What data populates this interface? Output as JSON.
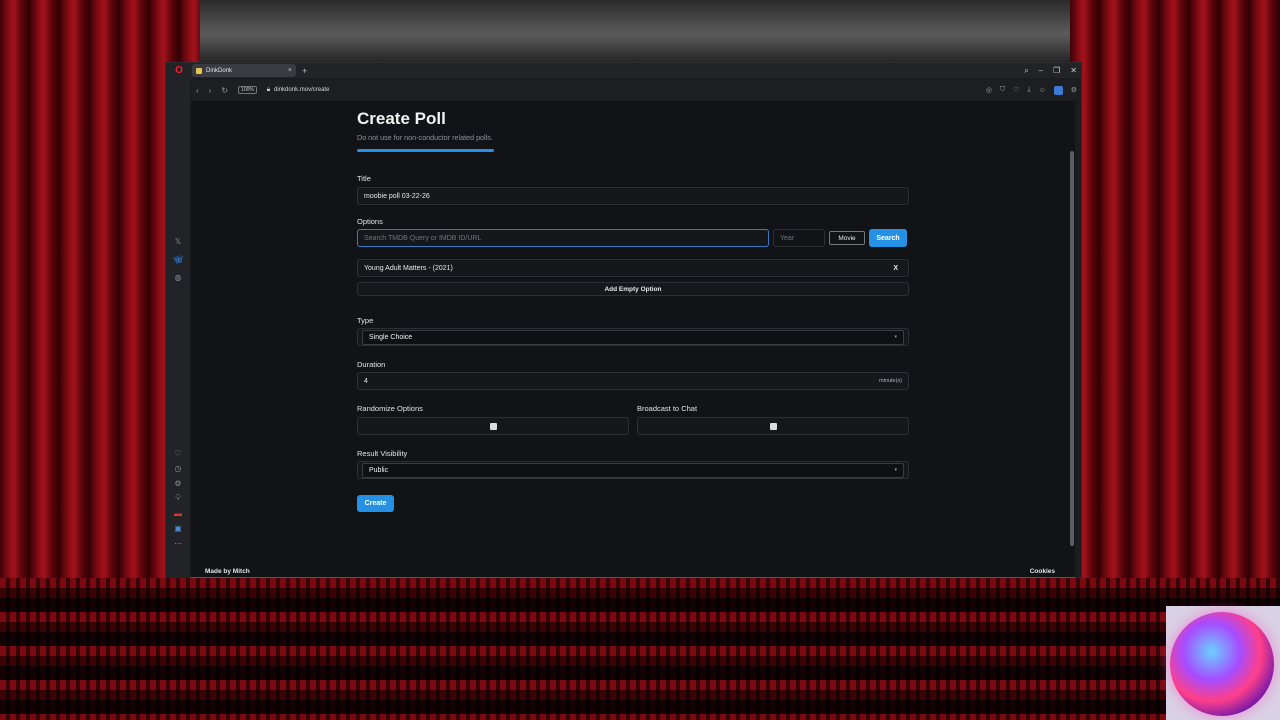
{
  "browser": {
    "tab_title": "DinkDonk",
    "address": "dinkdonk.mov/create",
    "zoom": "100%"
  },
  "page": {
    "title": "Create Poll",
    "subtitle": "Do not use for non-conductor related polls.",
    "title_label": "Title",
    "title_value": "moobie poll 03-22-26",
    "options_label": "Options",
    "search_placeholder": "Search TMDB Query or IMDB ID/URL",
    "year_placeholder": "Year",
    "media_type": "Movie",
    "search_button": "Search",
    "options": [
      {
        "label": "Young Adult Matters - (2021)",
        "remove": "X"
      }
    ],
    "add_empty_option": "Add Empty Option",
    "type_label": "Type",
    "type_value": "Single Choice",
    "duration_label": "Duration",
    "duration_value": "4",
    "duration_unit": "minute(s)",
    "randomize_label": "Randomize Options",
    "randomize_checked": true,
    "broadcast_label": "Broadcast to Chat",
    "broadcast_checked": true,
    "visibility_label": "Result Visibility",
    "visibility_value": "Public",
    "create_button": "Create"
  },
  "footer": {
    "made_by": "Made by Mitch",
    "cookies": "Cookies"
  },
  "colors": {
    "accent": "#2591e5",
    "page_bg": "#121317"
  }
}
